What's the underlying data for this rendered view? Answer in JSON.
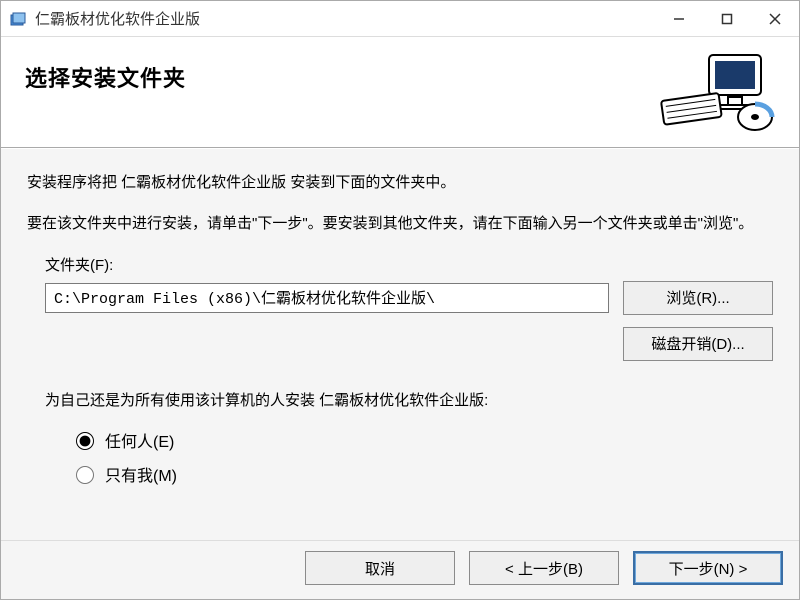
{
  "window": {
    "title": "仁霸板材优化软件企业版"
  },
  "header": {
    "heading": "选择安装文件夹"
  },
  "body": {
    "line1": "安装程序将把 仁霸板材优化软件企业版 安装到下面的文件夹中。",
    "line2": "要在该文件夹中进行安装，请单击\"下一步\"。要安装到其他文件夹，请在下面输入另一个文件夹或单击\"浏览\"。",
    "folder_label": "文件夹(F):",
    "folder_value": "C:\\Program Files (x86)\\仁霸板材优化软件企业版\\",
    "browse_btn": "浏览(R)...",
    "diskcost_btn": "磁盘开销(D)...",
    "install_for_label": "为自己还是为所有使用该计算机的人安装 仁霸板材优化软件企业版:",
    "radios": {
      "everyone": "任何人(E)",
      "justme": "只有我(M)",
      "selected": "everyone"
    }
  },
  "footer": {
    "cancel": "取消",
    "back": "< 上一步(B)",
    "next": "下一步(N) >"
  }
}
